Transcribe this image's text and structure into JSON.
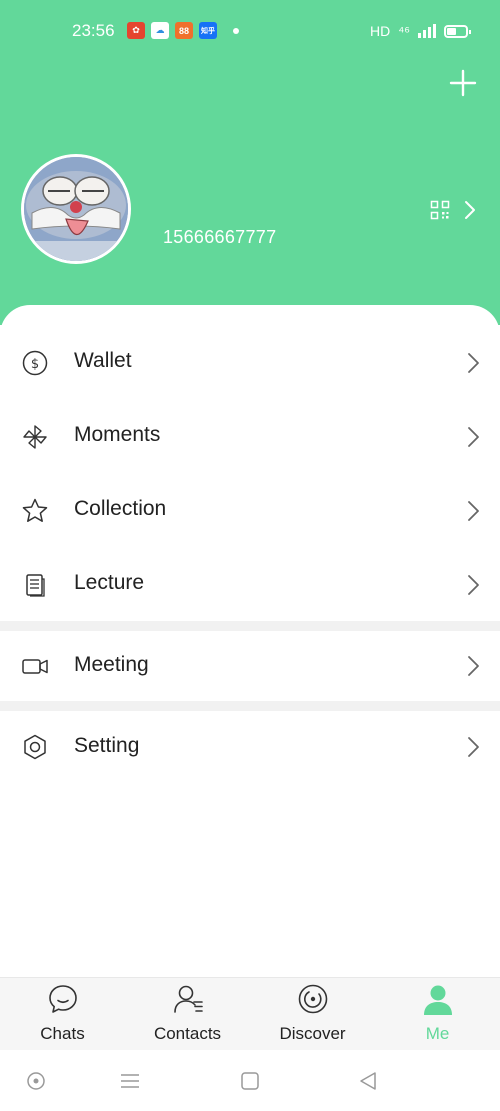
{
  "status_bar": {
    "time": "23:56",
    "app_icons": [
      {
        "name": "red-app-icon",
        "color": "#e5452f",
        "glyph": "✿"
      },
      {
        "name": "cloud-app-icon",
        "color": "#2f8fe0",
        "glyph": "☁"
      },
      {
        "name": "orange-app-icon",
        "color": "#f0702c",
        "glyph": "88"
      },
      {
        "name": "zhihu-app-icon",
        "color": "#1772f6",
        "glyph": "知乎"
      }
    ],
    "network_label": "HD",
    "signal_label": "⁴⁶"
  },
  "profile": {
    "phone": "15666667777"
  },
  "menu": [
    {
      "id": "wallet",
      "label": "Wallet",
      "icon": "wallet-icon"
    },
    {
      "id": "moments",
      "label": "Moments",
      "icon": "moments-icon"
    },
    {
      "id": "collection",
      "label": "Collection",
      "icon": "star-icon"
    },
    {
      "id": "lecture",
      "label": "Lecture",
      "icon": "document-icon"
    },
    {
      "id": "meeting",
      "label": "Meeting",
      "icon": "video-camera-icon"
    },
    {
      "id": "setting",
      "label": "Setting",
      "icon": "gear-icon"
    }
  ],
  "tabs": [
    {
      "id": "chats",
      "label": "Chats",
      "icon": "chat-bubble-icon",
      "active": false
    },
    {
      "id": "contacts",
      "label": "Contacts",
      "icon": "contacts-icon",
      "active": false
    },
    {
      "id": "discover",
      "label": "Discover",
      "icon": "compass-icon",
      "active": false
    },
    {
      "id": "me",
      "label": "Me",
      "icon": "person-icon",
      "active": true
    }
  ],
  "colors": {
    "accent": "#62d89a",
    "text": "#222222",
    "icon": "#333333"
  }
}
